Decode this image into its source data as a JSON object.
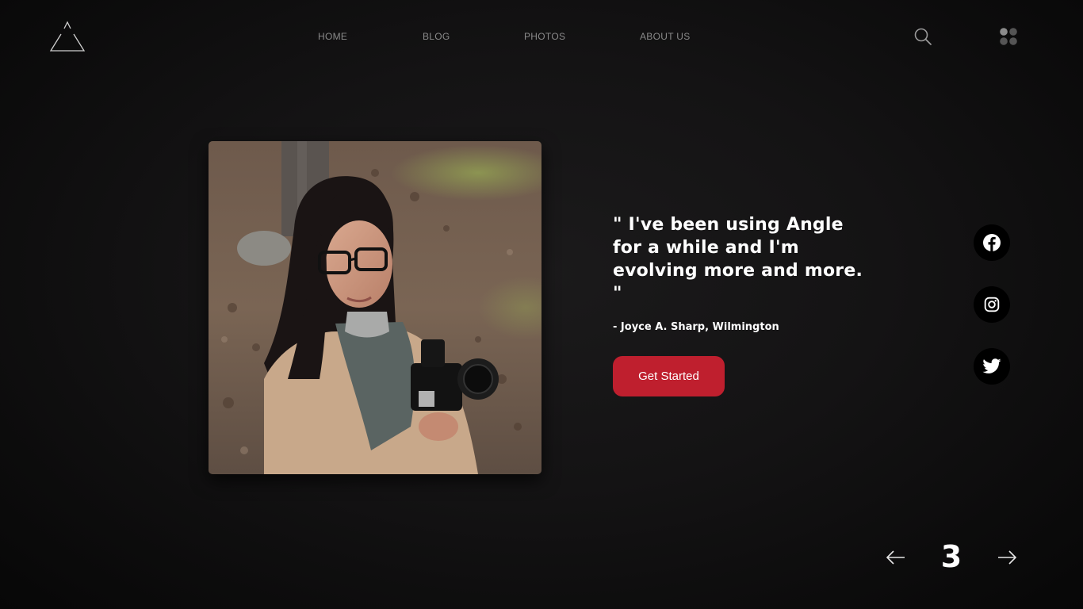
{
  "brand": {
    "logo_icon": "triangle-logo-icon"
  },
  "nav": {
    "items": [
      {
        "label": "HOME"
      },
      {
        "label": "BLOG"
      },
      {
        "label": "PHOTOS"
      },
      {
        "label": "ABOUT US"
      }
    ]
  },
  "header_actions": {
    "search_icon": "search-icon",
    "menu_icon": "app-grid-icon"
  },
  "testimonial": {
    "quote": "\" I've been using Angle for a while and I'm evolving more and more. \"",
    "author": "- Joyce A. Sharp, Wilmington",
    "cta_label": "Get Started",
    "cta_color": "#bf1f2e"
  },
  "social": [
    {
      "icon": "facebook-icon"
    },
    {
      "icon": "instagram-icon"
    },
    {
      "icon": "twitter-icon"
    }
  ],
  "pager": {
    "current_page": "3",
    "prev_icon": "arrow-left-icon",
    "next_icon": "arrow-right-icon"
  }
}
